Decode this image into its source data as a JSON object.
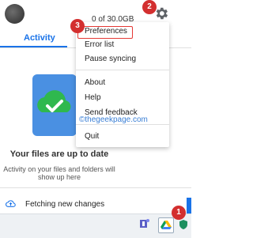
{
  "header": {
    "storage_text": "0 of 30.0GB"
  },
  "tabs": {
    "activity_label": "Activity"
  },
  "status": {
    "title": "Your files are up to date",
    "subtitle": "Activity on your files and folders will show up here"
  },
  "footer": {
    "fetch_label": "Fetching new changes"
  },
  "menu": {
    "items": [
      {
        "label": "Preferences"
      },
      {
        "label": "Error list"
      },
      {
        "label": "Pause syncing"
      },
      {
        "label": "About"
      },
      {
        "label": "Help"
      },
      {
        "label": "Send feedback"
      },
      {
        "label": "Quit"
      }
    ]
  },
  "badges": {
    "one": "1",
    "two": "2",
    "three": "3"
  },
  "watermark": "©thegeekpage.com",
  "colors": {
    "accent": "#1a73e8",
    "badge": "#d32f2f",
    "highlight_box": "#e53935",
    "cloud_green": "#2fb84e",
    "cloud_blue": "#4285f4"
  }
}
